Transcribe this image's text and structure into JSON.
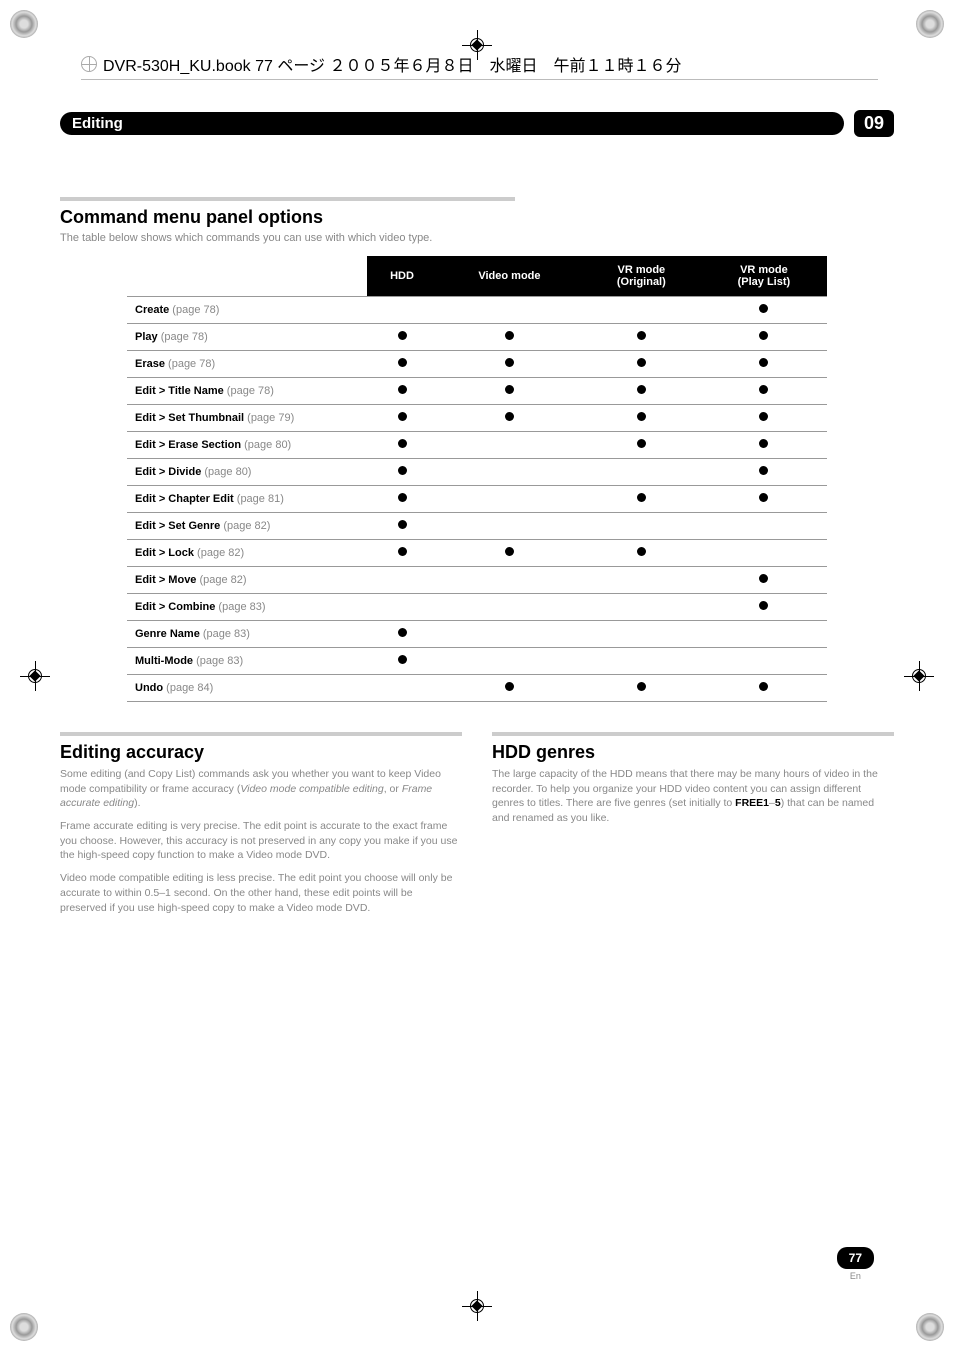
{
  "header_file_info": "DVR-530H_KU.book 77 ページ ２００５年６月８日　水曜日　午前１１時１６分",
  "section": {
    "title": "Editing",
    "number": "09"
  },
  "command_menu": {
    "title": "Command menu panel options",
    "desc": "The table below shows which commands you can use with which video type.",
    "columns": [
      "",
      "HDD",
      "Video mode",
      "VR mode (Original)",
      "VR mode (Play List)"
    ],
    "rows": [
      {
        "label_bold": "Create",
        "label_rest": " (page 78)",
        "cells": [
          false,
          false,
          false,
          true
        ]
      },
      {
        "label_bold": "Play",
        "label_rest": " (page 78)",
        "cells": [
          true,
          true,
          true,
          true
        ]
      },
      {
        "label_bold": "Erase",
        "label_rest": " (page 78)",
        "cells": [
          true,
          true,
          true,
          true
        ]
      },
      {
        "label_bold": "Edit > Title Name",
        "label_rest": " (page 78)",
        "cells": [
          true,
          true,
          true,
          true
        ]
      },
      {
        "label_bold": "Edit > Set Thumbnail",
        "label_rest": " (page 79)",
        "cells": [
          true,
          true,
          true,
          true
        ]
      },
      {
        "label_bold": "Edit > Erase Section",
        "label_rest": " (page 80)",
        "cells": [
          true,
          false,
          true,
          true
        ]
      },
      {
        "label_bold": "Edit > Divide",
        "label_rest": " (page 80)",
        "cells": [
          true,
          false,
          false,
          true
        ]
      },
      {
        "label_bold": "Edit > Chapter Edit",
        "label_rest": " (page 81)",
        "cells": [
          true,
          false,
          true,
          true
        ]
      },
      {
        "label_bold": "Edit > Set Genre",
        "label_rest": " (page 82)",
        "cells": [
          true,
          false,
          false,
          false
        ]
      },
      {
        "label_bold": "Edit > Lock",
        "label_rest": " (page 82)",
        "cells": [
          true,
          true,
          true,
          false
        ]
      },
      {
        "label_bold": "Edit > Move",
        "label_rest": " (page 82)",
        "cells": [
          false,
          false,
          false,
          true
        ]
      },
      {
        "label_bold": "Edit > Combine",
        "label_rest": " (page 83)",
        "cells": [
          false,
          false,
          false,
          true
        ]
      },
      {
        "label_bold": "Genre Name",
        "label_rest": " (page 83)",
        "cells": [
          true,
          false,
          false,
          false
        ]
      },
      {
        "label_bold": "Multi-Mode",
        "label_rest": " (page 83)",
        "cells": [
          true,
          false,
          false,
          false
        ]
      },
      {
        "label_bold": "Undo",
        "label_rest": " (page 84)",
        "cells": [
          false,
          true,
          true,
          true
        ]
      }
    ]
  },
  "editing_accuracy": {
    "title": "Editing accuracy",
    "p1_a": "Some editing (and Copy List) commands ask you whether you want to keep Video mode compatibility or frame accuracy (",
    "p1_i1": "Video mode compatible editing",
    "p1_b": ", or ",
    "p1_i2": "Frame accurate editing",
    "p1_c": ").",
    "p2": "Frame accurate editing is very precise. The edit point is accurate to the exact frame you choose. However, this accuracy is not preserved in any copy you make if you use the high-speed copy function to make a Video mode DVD.",
    "p3": "Video mode compatible editing is less precise. The edit point you choose will only be accurate to within 0.5–1 second. On the other hand, these edit points will be preserved if you use high-speed copy to make a Video mode DVD."
  },
  "hdd_genres": {
    "title": "HDD genres",
    "p1_a": "The large capacity of the HDD means that there may be many hours of video in the recorder. To help you organize your HDD video content you can assign different genres to titles. There are five genres (set initially to ",
    "p1_bold1": "FREE1",
    "p1_b": "–",
    "p1_bold2": "5",
    "p1_c": ") that can be named and renamed as you like."
  },
  "page": {
    "number": "77",
    "lang": "En"
  }
}
